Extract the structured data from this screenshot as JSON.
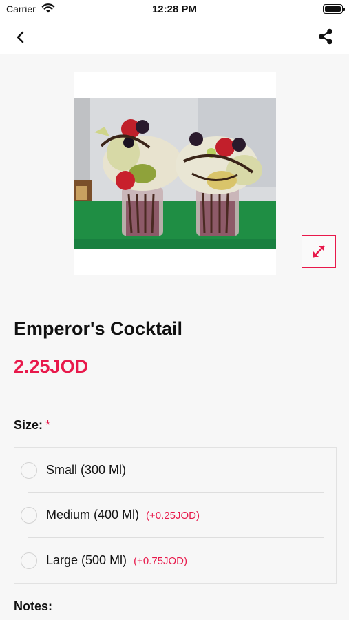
{
  "status_bar": {
    "carrier": "Carrier",
    "time": "12:28 PM"
  },
  "nav": {
    "back_icon": "chevron-left-icon",
    "share_icon": "share-icon"
  },
  "product": {
    "image_alt": "Emperor's Cocktail photo",
    "name": "Emperor's Cocktail",
    "price": "2.25JOD",
    "expand_icon": "expand-icon"
  },
  "size": {
    "label": "Size:",
    "required_mark": "*",
    "options": [
      {
        "label": "Small (300 Ml)",
        "extra": ""
      },
      {
        "label": "Medium (400 Ml)",
        "extra": "(+0.25JOD)"
      },
      {
        "label": "Large (500 Ml)",
        "extra": "(+0.75JOD)"
      }
    ]
  },
  "notes": {
    "label": "Notes:"
  },
  "colors": {
    "accent": "#e8194b",
    "background": "#f7f7f7",
    "text": "#111111"
  }
}
